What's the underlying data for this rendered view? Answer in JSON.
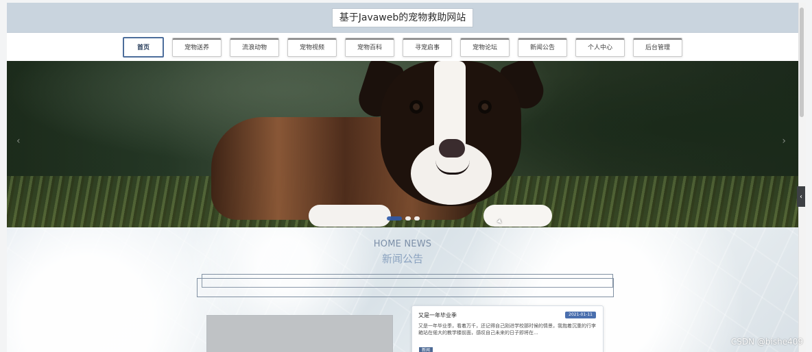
{
  "header": {
    "site_title": "基于Javaweb的宠物救助网站"
  },
  "nav": {
    "items": [
      {
        "label": "首页"
      },
      {
        "label": "宠物送养"
      },
      {
        "label": "流浪动物"
      },
      {
        "label": "宠物视频"
      },
      {
        "label": "宠物百科"
      },
      {
        "label": "寻宠启事"
      },
      {
        "label": "宠物论坛"
      },
      {
        "label": "新闻公告"
      },
      {
        "label": "个人中心"
      },
      {
        "label": "后台管理"
      }
    ]
  },
  "banner": {
    "left_arrow": "‹",
    "right_arrow": "›"
  },
  "news": {
    "section_title_en": "HOME NEWS",
    "section_title_zh": "新闻公告",
    "card": {
      "title": "又是一年毕业季",
      "date": "2021-01-11",
      "summary": "又是一年毕业季，看着万千，还记得自己刚进学校那时候的情景，我抱着沉重的行李箱站在偌大的教学楼前面，感叹自己未来的日子即将在...",
      "tag": "新闻"
    }
  },
  "side_handle": {
    "label": "‹"
  },
  "watermark": {
    "text": "CSDN @bishe409"
  },
  "colors": {
    "header_bg": "#c9d4de",
    "active_nav": "#4c6d9b",
    "news_date_bg": "#4a6fae"
  }
}
